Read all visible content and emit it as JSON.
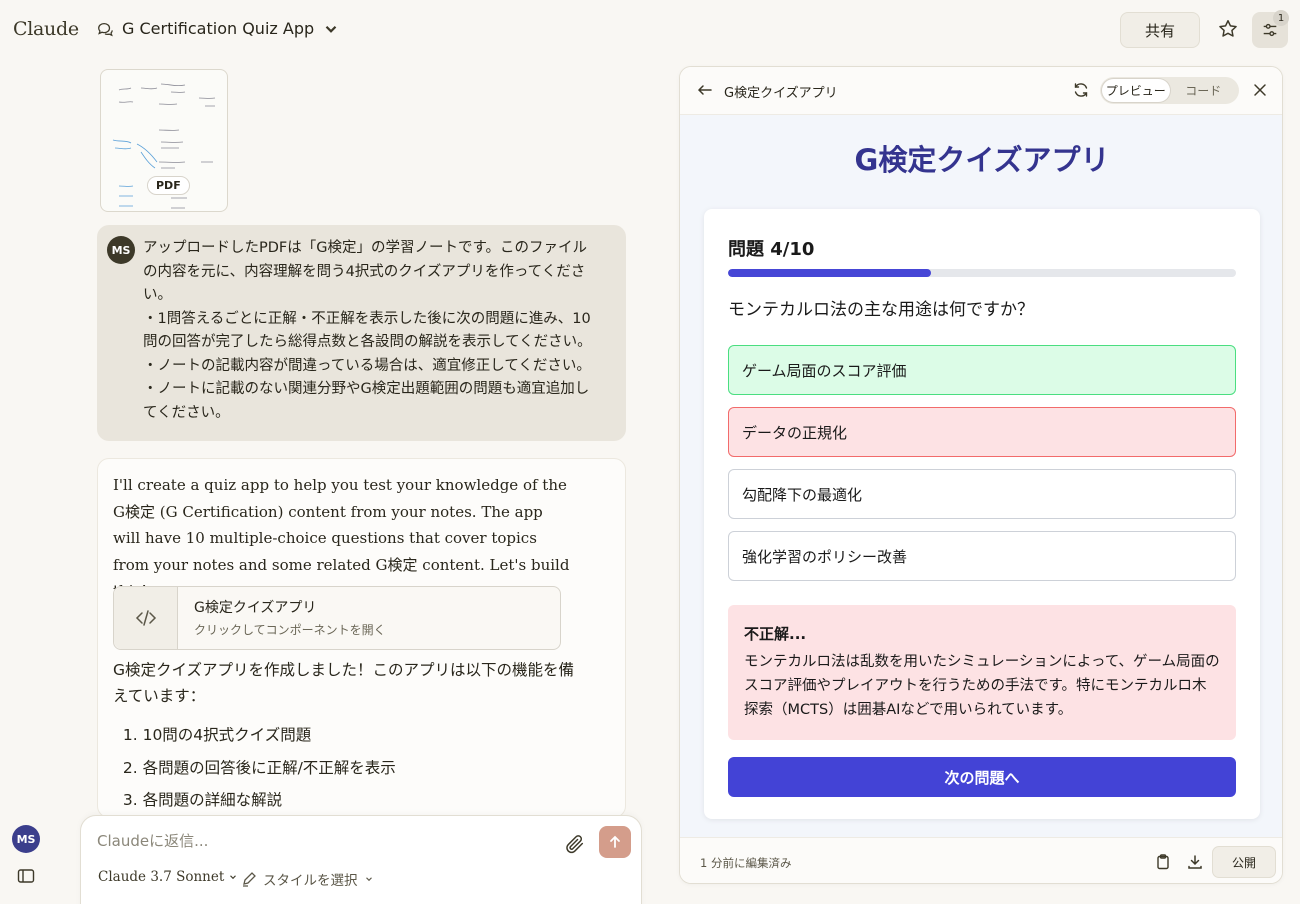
{
  "header": {
    "logo": "Claude",
    "chat_title": "G Certification Quiz App",
    "share_label": "共有",
    "settings_badge": "1"
  },
  "attachment": {
    "badge": "PDF"
  },
  "user_message": {
    "avatar": "MS",
    "lines": [
      "アップロードしたPDFは「G検定」の学習ノートです。このファイルの内容を元に、内容理解を問う4択式のクイズアプリを作ってください。",
      "・1問答えるごとに正解・不正解を表示した後に次の問題に進み、10問の回答が完了したら総得点数と各設問の解説を表示してください。",
      "・ノートの記載内容が間違っている場合は、適宜修正してください。",
      "・ノートに記載のない関連分野やG検定出題範囲の問題も適宜追加してください。"
    ]
  },
  "assistant_message": {
    "intro": "I'll create a quiz app to help you test your knowledge of the G検定 (G Certification) content from your notes. The app will have 10 multiple-choice questions that cover topics from your notes and some related G検定 content. Let's build this!",
    "artifact_title": "G検定クイズアプリ",
    "artifact_subtitle": "クリックしてコンポーネントを開く",
    "outro": "G検定クイズアプリを作成しました！このアプリは以下の機能を備えています：",
    "features": [
      "10問の4択式クイズ問題",
      "各問題の回答後に正解/不正解を表示",
      "各問題の詳細な解説"
    ]
  },
  "composer": {
    "placeholder": "Claudeに返信...",
    "model": "Claude 3.7 Sonnet",
    "style": "スタイルを選択"
  },
  "user_avatar": "MS",
  "panel": {
    "title": "G検定クイズアプリ",
    "tab_preview": "プレビュー",
    "tab_code": "コード",
    "edited": "1 分前に編集済み",
    "publish": "公開"
  },
  "quiz": {
    "app_title": "G検定クイズアプリ",
    "counter": "問題 4/10",
    "progress": 0.4,
    "question": "モンテカルロ法の主な用途は何ですか？",
    "options": [
      "ゲーム局面のスコア評価",
      "データの正規化",
      "勾配降下の最適化",
      "強化学習のポリシー改善"
    ],
    "feedback_title": "不正解...",
    "feedback_text": "モンテカルロ法は乱数を用いたシミュレーションによって、ゲーム局面のスコア評価やプレイアウトを行うための手法です。特にモンテカルロ木探索（MCTS）は囲碁AIなどで用いられています。",
    "next_label": "次の問題へ"
  },
  "colors": {
    "accent": "#4343d6",
    "title": "#34348f",
    "correct_bg": "#dcfce7",
    "wrong_bg": "#fde2e4",
    "send": "#d49d8b"
  }
}
